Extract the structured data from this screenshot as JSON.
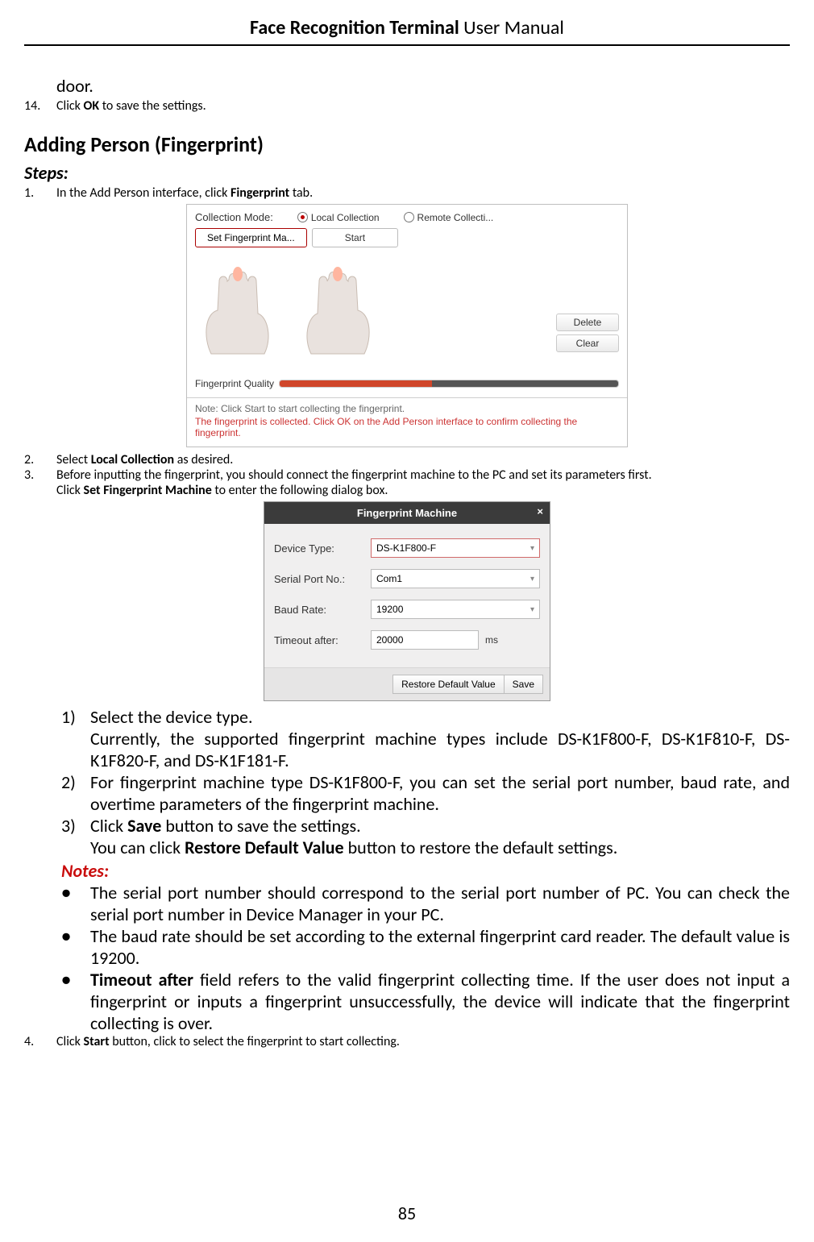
{
  "header": {
    "title_bold": "Face Recognition Terminal",
    "title_rest": "  User Manual"
  },
  "tail_prev": "door.",
  "step14": {
    "n": "14.",
    "pre": "Click ",
    "bold": "OK",
    "post": " to save the settings."
  },
  "section_heading": "Adding Person (Fingerprint)",
  "steps_label": "Steps:",
  "step1": {
    "n": "1.",
    "pre": "In the Add Person interface, click ",
    "bold": "Fingerprint",
    "post": " tab."
  },
  "figA": {
    "collection_label": "Collection Mode:",
    "radio_local": "Local Collection",
    "radio_remote": "Remote Collecti...",
    "btn_set": "Set Fingerprint Ma...",
    "btn_start": "Start",
    "btn_delete": "Delete",
    "btn_clear": "Clear",
    "fq_label": "Fingerprint Quality",
    "note1": "Note: Click Start to start collecting the fingerprint.",
    "note2": "The fingerprint is collected. Click OK on the Add Person interface to confirm collecting the fingerprint."
  },
  "step2": {
    "n": "2.",
    "pre": "Select ",
    "bold": "Local Collection",
    "post": " as desired."
  },
  "step3": {
    "n": "3.",
    "line1": "Before inputting the fingerprint, you should connect the fingerprint machine to the PC and set its parameters first.",
    "line2_pre": "Click ",
    "line2_bold": "Set Fingerprint Machine",
    "line2_post": " to enter the following dialog box."
  },
  "figB": {
    "title": "Fingerprint Machine",
    "rows": {
      "device_type": {
        "lbl": "Device Type:",
        "val": "DS-K1F800-F"
      },
      "serial": {
        "lbl": "Serial Port No.:",
        "val": "Com1"
      },
      "baud": {
        "lbl": "Baud Rate:",
        "val": "19200"
      },
      "timeout": {
        "lbl": "Timeout after:",
        "val": "20000",
        "unit": "ms"
      }
    },
    "btn_restore": "Restore Default Value",
    "btn_save": "Save"
  },
  "sub1": {
    "n": "1)",
    "t": "Select the device type."
  },
  "sub1b": "Currently, the supported fingerprint machine types include DS-K1F800-F, DS-K1F810-F, DS-K1F820-F, and DS-K1F181-F.",
  "sub2": {
    "n": "2)",
    "t": "For fingerprint machine type DS-K1F800-F, you can set the serial port number, baud rate, and overtime parameters of the fingerprint machine."
  },
  "sub3": {
    "n": "3)",
    "pre": "Click ",
    "bold": "Save",
    "post": " button to save the settings."
  },
  "sub3b": {
    "pre": "You can click ",
    "bold": "Restore Default Value",
    "post": " button to restore the default settings."
  },
  "notes_label": "Notes:",
  "bullet1": "The serial port number should correspond to the serial port number of PC. You can check the serial port number in Device Manager in your PC.",
  "bullet2": "The baud rate should be set according to the external fingerprint card reader. The default value is 19200.",
  "bullet3": {
    "bold": "Timeout after",
    "rest": " field refers to the valid fingerprint collecting time. If the user does not input a fingerprint or inputs a fingerprint unsuccessfully, the device will indicate that the fingerprint collecting is over."
  },
  "step4": {
    "n": "4.",
    "pre": "Click ",
    "bold": "Start",
    "post": " button, click to select the fingerprint to start collecting."
  },
  "page_number": "85"
}
